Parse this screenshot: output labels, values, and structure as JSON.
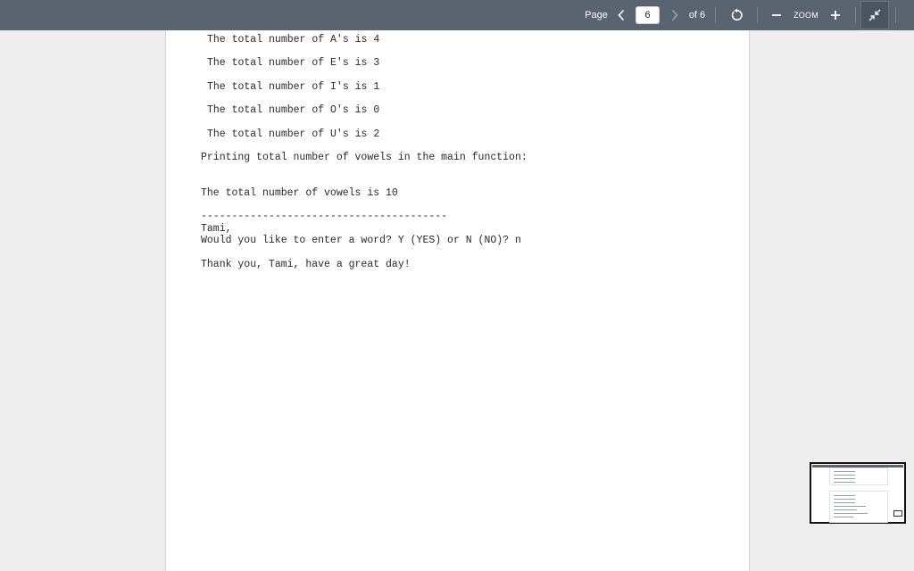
{
  "toolbar": {
    "page_label": "Page",
    "current_page": "6",
    "of_label": "of 6",
    "zoom_label": "ZOOM"
  },
  "document": {
    "lines": [
      "The total number of A's is 4",
      "The total number of E's is 3",
      "The total number of I's is 1",
      "The total number of O's is 0",
      "The total number of U's is 2",
      "Printing total number of vowels in the main function:",
      "The total number of vowels is 10",
      "----------------------------------------",
      "Tami,",
      "Would you like to enter a word? Y (YES) or N (NO)? n",
      "Thank you, Tami, have a great day!"
    ]
  },
  "icons": {
    "prev": "chevron-left-icon",
    "next": "chevron-right-icon",
    "rotate": "rotate-icon",
    "zoom_out": "minus-icon",
    "zoom_in": "plus-icon",
    "fit": "collapse-icon"
  },
  "colors": {
    "toolbar_bg": "#5a6470",
    "background": "#eeeeee",
    "page_bg": "#ffffff"
  }
}
